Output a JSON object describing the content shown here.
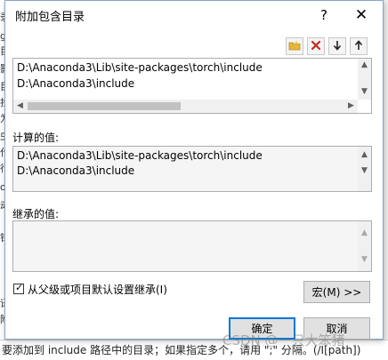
{
  "background": {
    "left_chars": [
      "录",
      "g",
      "目",
      "影",
      "目",
      "找",
      "为",
      "虫",
      "代",
      "行",
      "o",
      "动",
      "错",
      "译",
      "附"
    ],
    "bottom_text": "要添加到 include 路径中的目录；如果指定多个，请用 \";\" 分隔。(/I[path])"
  },
  "dialog": {
    "title": "附加包含目录",
    "help_glyph": "?",
    "close_glyph": "✕"
  },
  "toolbar": {
    "new_folder_icon": "folder-new-icon",
    "delete_icon": "delete-icon",
    "move_down_glyph": "🡓",
    "move_up_glyph": "🡑"
  },
  "include_list": {
    "lines": [
      "D:\\Anaconda3\\Lib\\site-packages\\torch\\include",
      "D:\\Anaconda3\\include"
    ]
  },
  "computed": {
    "label": "计算的值:",
    "lines": [
      "D:\\Anaconda3\\Lib\\site-packages\\torch\\include",
      "D:\\Anaconda3\\include"
    ]
  },
  "inherited": {
    "label": "继承的值:",
    "lines": []
  },
  "inherit_checkbox": {
    "label": "从父级或项目默认设置继承(I)",
    "checked": true
  },
  "buttons": {
    "macro": "宏(M) >>",
    "ok": "确定",
    "cancel": "取消"
  },
  "watermark": "CSDN @一只大笨猪",
  "colors": {
    "dialog_border": "#8ba6c6",
    "default_button_border": "#0078d7",
    "delete_red": "#c42b1c",
    "folder_yellow": "#e8b53a"
  }
}
